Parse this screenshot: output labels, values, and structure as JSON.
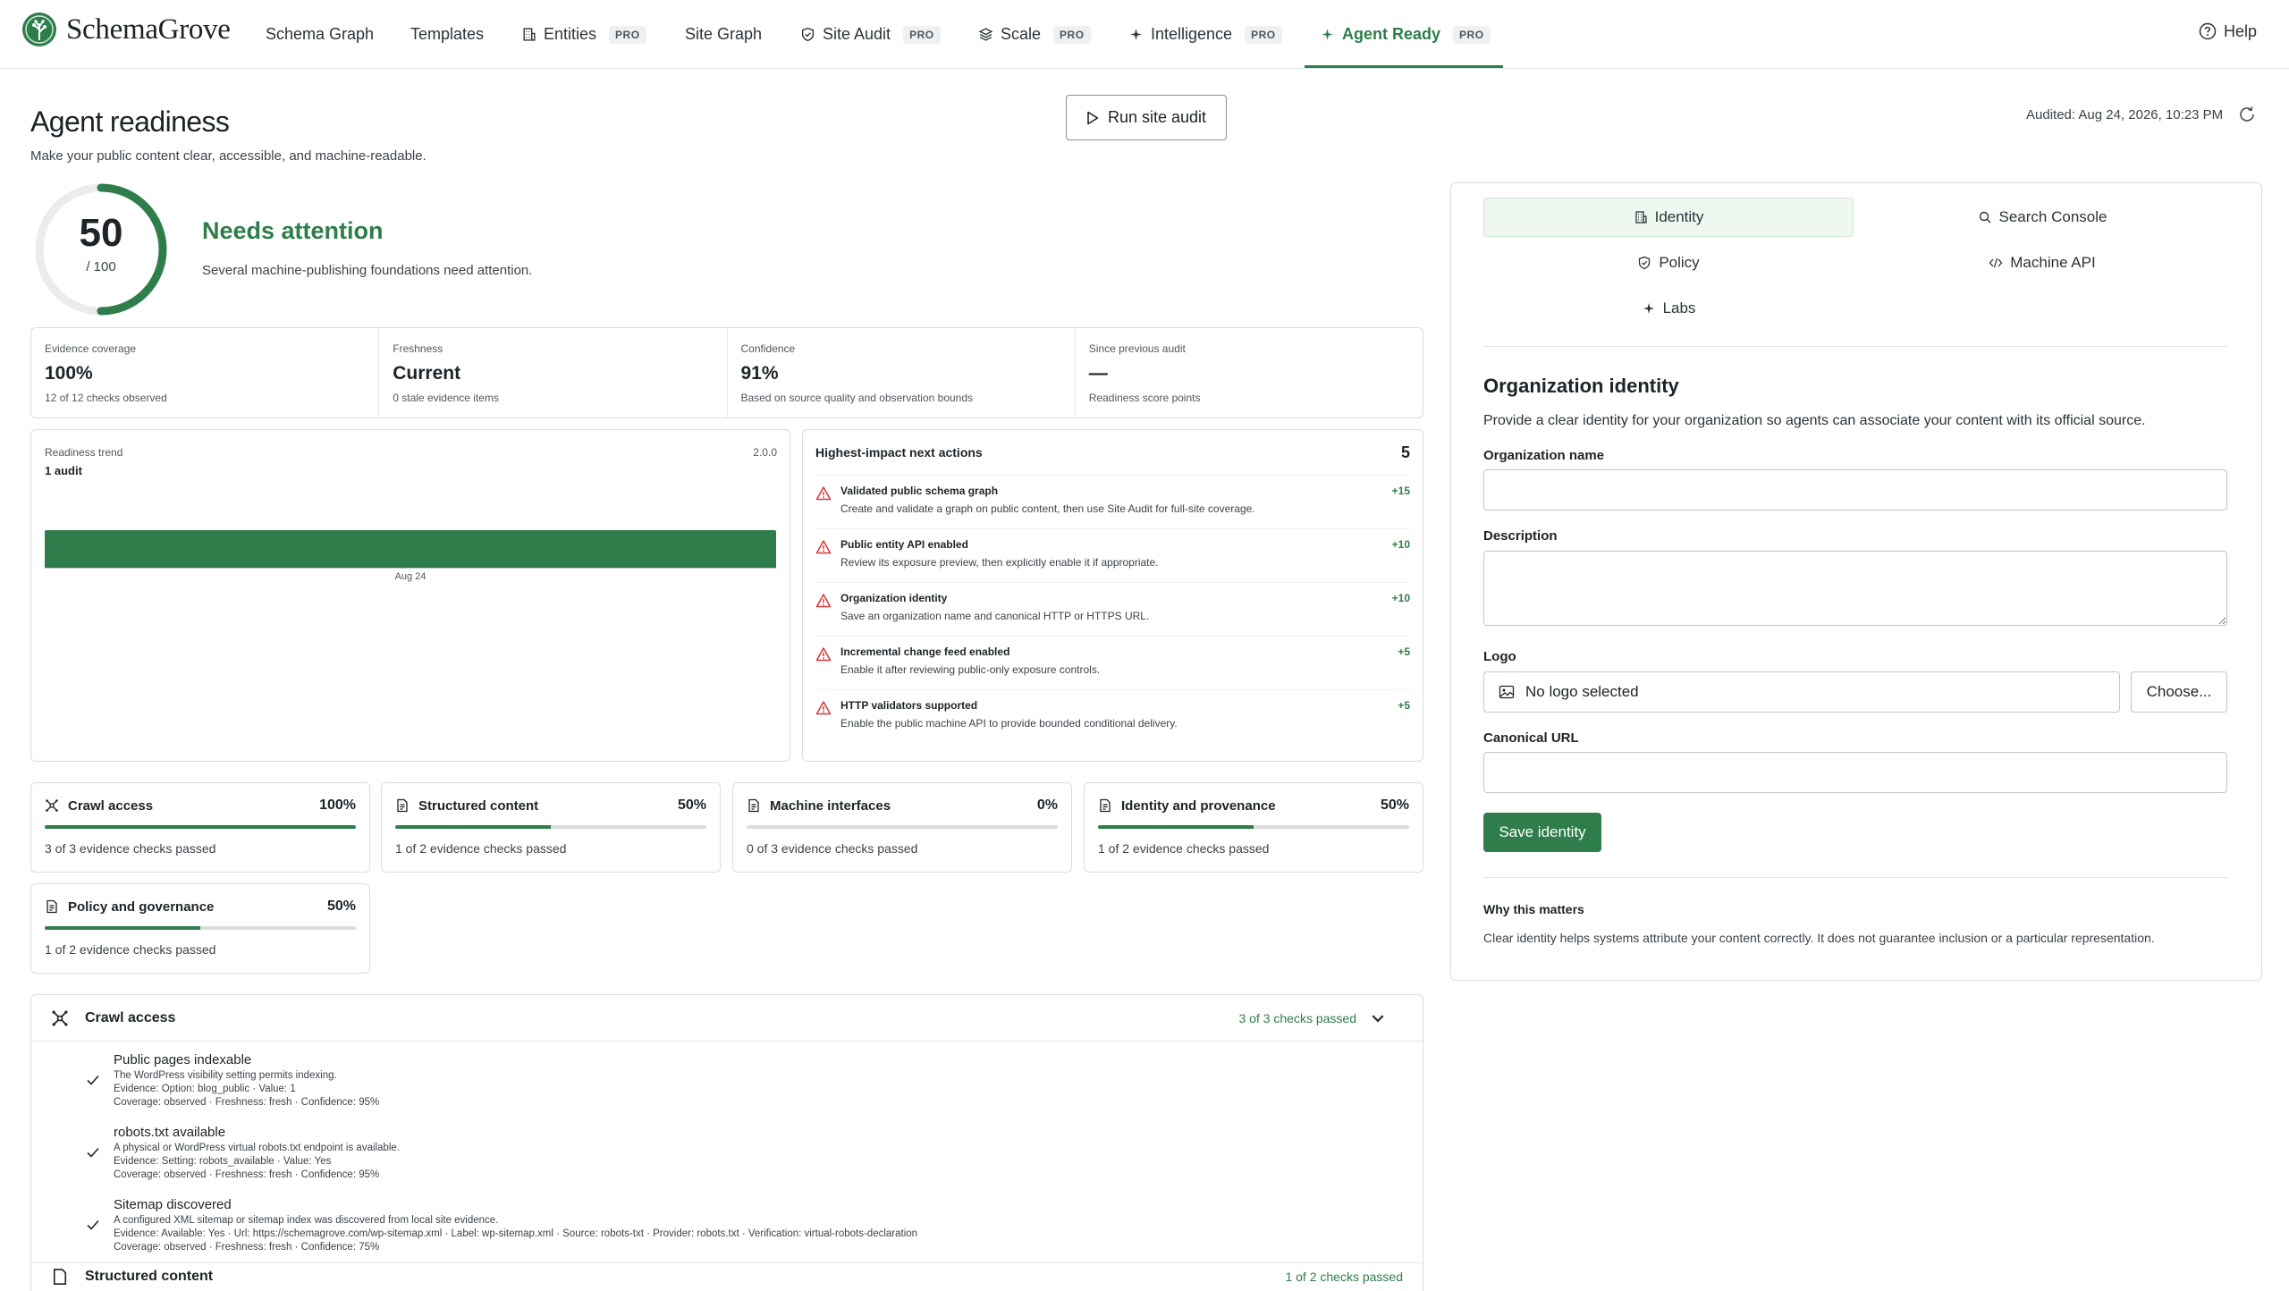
{
  "brand": {
    "name": "SchemaGrove"
  },
  "nav": {
    "items": [
      {
        "label": "Schema Graph"
      },
      {
        "label": "Templates"
      },
      {
        "label": "Entities",
        "badge": "PRO"
      },
      {
        "label": "Site Graph"
      },
      {
        "label": "Site Audit",
        "badge": "PRO"
      },
      {
        "label": "Scale",
        "badge": "PRO"
      },
      {
        "label": "Intelligence",
        "badge": "PRO"
      },
      {
        "label": "Agent Ready",
        "badge": "PRO",
        "active": true
      }
    ],
    "help": "Help"
  },
  "header": {
    "title": "Agent readiness",
    "subtitle": "Make your public content clear, accessible, and machine-readable.",
    "run_button": "Run site audit",
    "audited": "Audited: Aug 24, 2026, 10:23 PM"
  },
  "score": {
    "value": "50",
    "denominator": "/ 100",
    "fraction": 0.5,
    "status": "Needs attention",
    "status_note": "Several machine-publishing foundations need attention."
  },
  "stats": [
    {
      "label": "Evidence coverage",
      "value": "100%",
      "note": "12 of 12 checks observed"
    },
    {
      "label": "Freshness",
      "value": "Current",
      "note": "0 stale evidence items"
    },
    {
      "label": "Confidence",
      "value": "91%",
      "note": "Based on source quality and observation bounds"
    },
    {
      "label": "Since previous audit",
      "value": "—",
      "note": "Readiness score points"
    }
  ],
  "trend": {
    "label": "Readiness trend",
    "version": "2.0.0",
    "count": "1 audit",
    "tick": "Aug 24"
  },
  "actions": {
    "title": "Highest-impact next actions",
    "count": "5",
    "items": [
      {
        "title": "Validated public schema graph",
        "desc": "Create and validate a graph on public content, then use Site Audit for full-site coverage.",
        "points": "+15"
      },
      {
        "title": "Public entity API enabled",
        "desc": "Review its exposure preview, then explicitly enable it if appropriate.",
        "points": "+10"
      },
      {
        "title": "Organization identity",
        "desc": "Save an organization name and canonical HTTP or HTTPS URL.",
        "points": "+10"
      },
      {
        "title": "Incremental change feed enabled",
        "desc": "Enable it after reviewing public-only exposure controls.",
        "points": "+5"
      },
      {
        "title": "HTTP validators supported",
        "desc": "Enable the public machine API to provide bounded conditional delivery.",
        "points": "+5"
      }
    ]
  },
  "categories": [
    {
      "name": "Crawl access",
      "pct": "100%",
      "fill": 1.0,
      "note": "3 of 3 evidence checks passed",
      "icon": "crawl-icon"
    },
    {
      "name": "Structured content",
      "pct": "50%",
      "fill": 0.5,
      "note": "1 of 2 evidence checks passed",
      "icon": "document-icon"
    },
    {
      "name": "Machine interfaces",
      "pct": "0%",
      "fill": 0.0,
      "note": "0 of 3 evidence checks passed",
      "icon": "document-icon"
    },
    {
      "name": "Identity and provenance",
      "pct": "50%",
      "fill": 0.5,
      "note": "1 of 2 evidence checks passed",
      "icon": "document-icon"
    },
    {
      "name": "Policy and governance",
      "pct": "50%",
      "fill": 0.5,
      "note": "1 of 2 evidence checks passed",
      "icon": "document-icon"
    }
  ],
  "crawl_detail": {
    "title": "Crawl access",
    "passed": "3 of 3 checks passed",
    "checks": [
      {
        "title": "Public pages indexable",
        "lines": [
          "The WordPress visibility setting permits indexing.",
          "Evidence: Option: blog_public · Value: 1",
          "Coverage: observed · Freshness: fresh · Confidence: 95%"
        ]
      },
      {
        "title": "robots.txt available",
        "lines": [
          "A physical or WordPress virtual robots.txt endpoint is available.",
          "Evidence: Setting: robots_available · Value: Yes",
          "Coverage: observed · Freshness: fresh · Confidence: 95%"
        ]
      },
      {
        "title": "Sitemap discovered",
        "lines": [
          "A configured XML sitemap or sitemap index was discovered from local site evidence.",
          "Evidence: Available: Yes · Url: https://schemagrove.com/wp-sitemap.xml · Label: wp-sitemap.xml · Source: robots-txt · Provider: robots.txt · Verification: virtual-robots-declaration",
          "Coverage: observed · Freshness: fresh · Confidence: 75%"
        ]
      }
    ],
    "next_section": "Structured content",
    "next_passed": "1 of 2 checks passed"
  },
  "panel": {
    "tabs": [
      {
        "label": "Identity",
        "active": true
      },
      {
        "label": "Search Console"
      },
      {
        "label": "Policy"
      },
      {
        "label": "Machine API"
      },
      {
        "label": "Labs"
      }
    ],
    "title": "Organization identity",
    "subtitle": "Provide a clear identity for your organization so agents can associate your content with its official source.",
    "org_name_label": "Organization name",
    "org_name_value": "",
    "description_label": "Description",
    "description_value": "",
    "logo_label": "Logo",
    "logo_value": "No logo selected",
    "choose_button": "Choose...",
    "url_label": "Canonical URL",
    "url_value": "",
    "save_button": "Save identity",
    "why_title": "Why this matters",
    "why_text": "Clear identity helps systems attribute your content correctly. It does not guarantee inclusion or a particular representation."
  },
  "colors": {
    "accent": "#2e7d4a",
    "warning": "#d63638",
    "border": "#dcdcde"
  }
}
